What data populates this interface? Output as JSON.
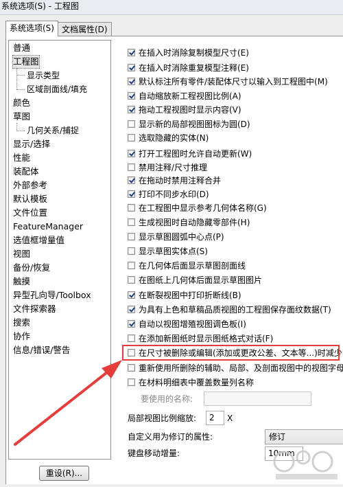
{
  "window": {
    "title": "系统选项(S) - 工程图"
  },
  "tabs": [
    {
      "label": "系统选项(S)",
      "active": true
    },
    {
      "label": "文档属性(D)",
      "active": false
    }
  ],
  "nav": [
    {
      "label": "普通"
    },
    {
      "label": "工程图",
      "selected": true
    },
    {
      "label": "显示类型"
    },
    {
      "label": "区域剖面线/填充"
    },
    {
      "label": "颜色"
    },
    {
      "label": "草图"
    },
    {
      "label": "几何关系/捕捉"
    },
    {
      "label": "显示/选择"
    },
    {
      "label": "性能"
    },
    {
      "label": "装配体"
    },
    {
      "label": "外部参考"
    },
    {
      "label": "默认模板"
    },
    {
      "label": "文件位置"
    },
    {
      "label": "FeatureManager"
    },
    {
      "label": "选值框增量值"
    },
    {
      "label": "视图"
    },
    {
      "label": "备份/恢复"
    },
    {
      "label": "触摸"
    },
    {
      "label": "异型孔向导/Toolbox"
    },
    {
      "label": "文件探索器"
    },
    {
      "label": "搜索"
    },
    {
      "label": "协作"
    },
    {
      "label": "信息/错误/警告"
    }
  ],
  "options": [
    {
      "label": "在插入时消除复制模型尺寸(E)",
      "checked": true
    },
    {
      "label": "在插入时消除重复模型注释(E)",
      "checked": true
    },
    {
      "label": "默认标注所有零件/装配体尺寸以输入到工程图中(M)",
      "checked": true
    },
    {
      "label": "自动缩放新工程视图比例(A)",
      "checked": true
    },
    {
      "label": "拖动工程视图时显示内容(V)",
      "checked": true
    },
    {
      "label": "显示新的局部视图图标为圆(D)",
      "checked": false
    },
    {
      "label": "选取隐藏的实体(N)",
      "checked": false
    },
    {
      "label": "打开工程图时允许自动更新(W)",
      "checked": true
    },
    {
      "label": "禁用注释/尺寸推理",
      "checked": false
    },
    {
      "label": "在拖动时禁用注释合并",
      "checked": true
    },
    {
      "label": "打印不同步水印(D)",
      "checked": true
    },
    {
      "label": "在工程图中显示参考几何体名称(G)",
      "checked": false
    },
    {
      "label": "生成视图时自动隐藏零部件(H)",
      "checked": false
    },
    {
      "label": "显示草图圆弧中心点(P)",
      "checked": false
    },
    {
      "label": "显示草图实体点(S)",
      "checked": false
    },
    {
      "label": "在几何体后面显示草图剖面线",
      "checked": false
    },
    {
      "label": "在图纸上几何体后面显示草图图片",
      "checked": false
    },
    {
      "label": "在断裂视图中打印折断线(B)",
      "checked": true
    },
    {
      "label": "为具有上色和草稿品质视图的工程图保存面纹数据(T)",
      "checked": true
    },
    {
      "label": "自动以视图增殖视图调色板(I)",
      "checked": true
    },
    {
      "label": "在添加新图纸时显示图纸格式对话(F)",
      "checked": false
    },
    {
      "label": "在尺寸被删除或编辑(添加或更改公差、文本等...)时减少",
      "checked": false
    },
    {
      "label": "重新使用所删除的辅助、局部、及剖面视图中的视图字母",
      "checked": false
    },
    {
      "label": "在材料明细表中覆盖数量列名称",
      "checked": false
    }
  ],
  "fields": {
    "qty_name_label": "要使用的名称:",
    "qty_name_value": "",
    "detail_scale_label": "局部视图比例缩放:",
    "detail_scale_value": "2",
    "detail_scale_unit": "X",
    "revision_label": "自定义用为修订的属性:",
    "revision_value": "修订",
    "nudge_label": "键盘移动增量:",
    "nudge_value": "10mm"
  },
  "buttons": {
    "reset": "重设(R)..."
  },
  "watermark": "www.bxxxx.com",
  "colors": {
    "highlight": "#e53c3c",
    "arrow": "#e53c3c"
  }
}
